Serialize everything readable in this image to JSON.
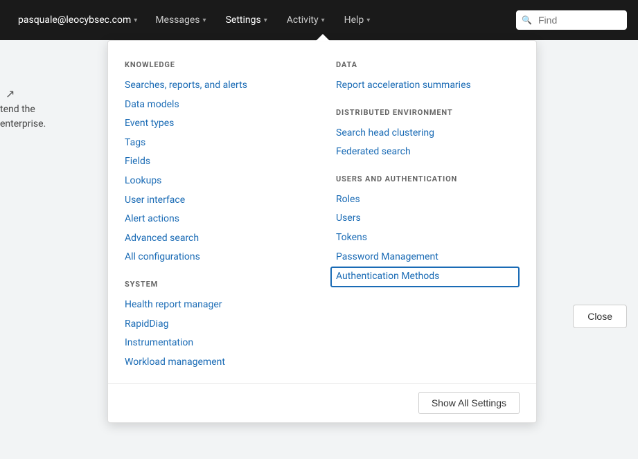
{
  "navbar": {
    "user": "pasquale@leocybsec.com",
    "messages": "Messages",
    "settings": "Settings",
    "activity": "Activity",
    "help": "Help",
    "find_placeholder": "Find"
  },
  "page": {
    "expand_icon": "↗",
    "text_line1": "tend the",
    "text_line2": "enterprise."
  },
  "dropdown": {
    "knowledge_label": "KNOWLEDGE",
    "knowledge_links": [
      "Searches, reports, and alerts",
      "Data models",
      "Event types",
      "Tags",
      "Fields",
      "Lookups",
      "User interface",
      "Alert actions",
      "Advanced search",
      "All configurations"
    ],
    "system_label": "SYSTEM",
    "system_links": [
      "Health report manager",
      "RapidDiag",
      "Instrumentation",
      "Workload management"
    ],
    "data_label": "DATA",
    "data_links": [
      "Report acceleration summaries"
    ],
    "distributed_label": "DISTRIBUTED ENVIRONMENT",
    "distributed_links": [
      "Search head clustering",
      "Federated search"
    ],
    "users_label": "USERS AND AUTHENTICATION",
    "users_links": [
      "Roles",
      "Users",
      "Tokens",
      "Password Management",
      "Authentication Methods"
    ],
    "highlighted_link": "Authentication Methods",
    "show_all_label": "Show All Settings",
    "close_label": "Close"
  }
}
